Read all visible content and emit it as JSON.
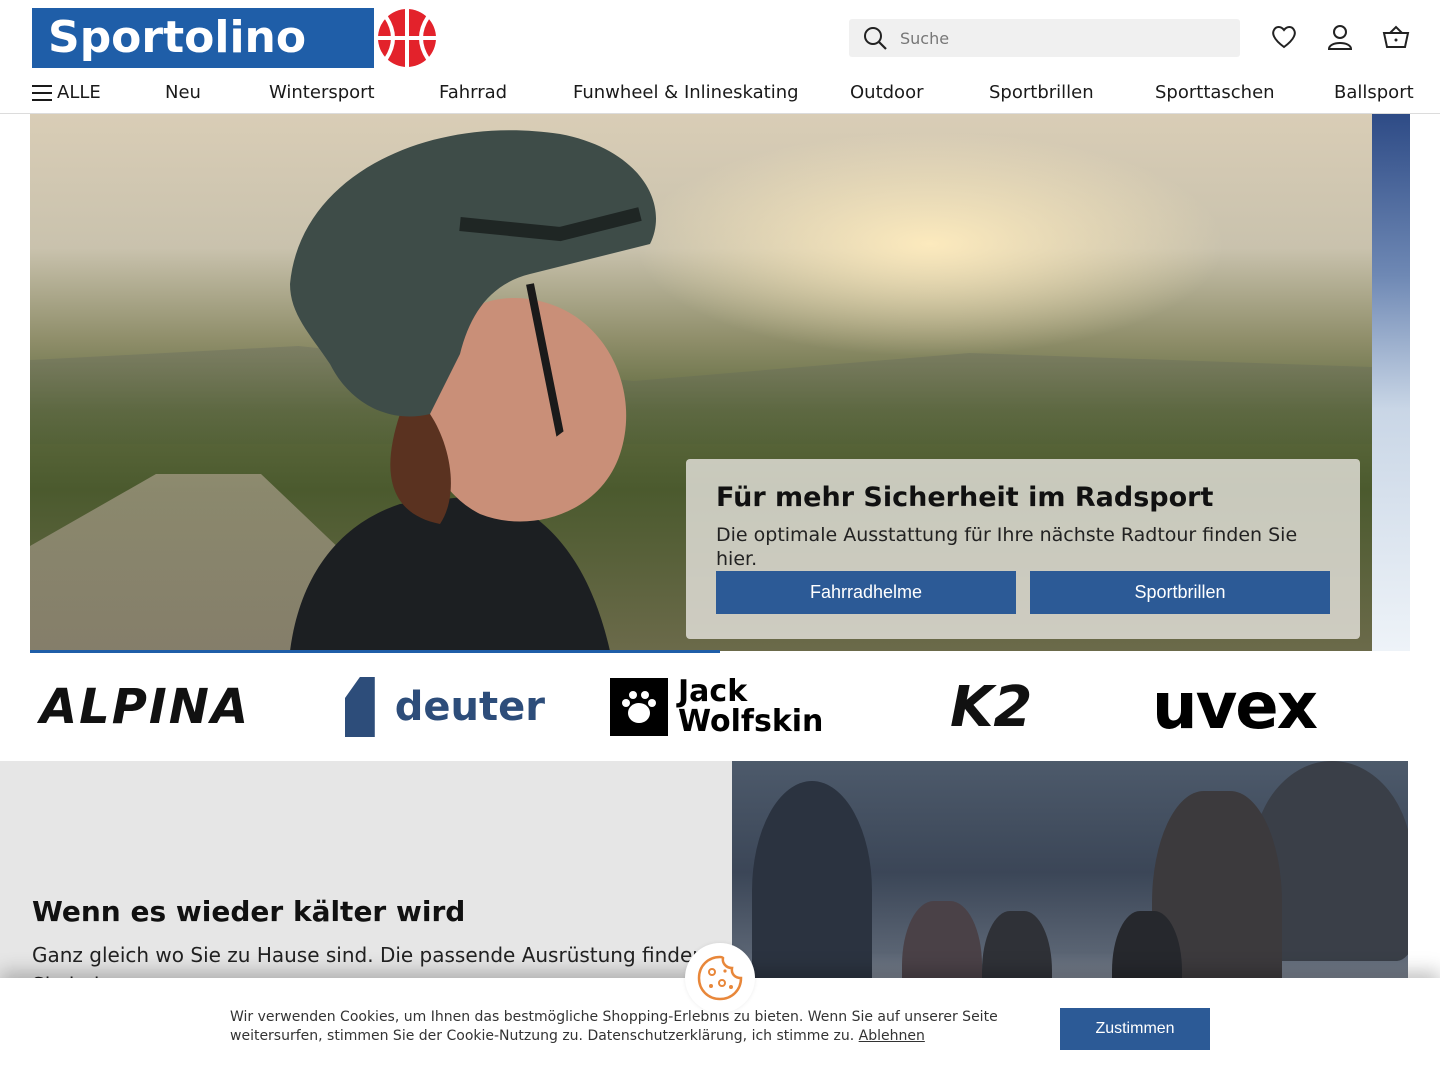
{
  "brand": {
    "logo_text": "Sportolino"
  },
  "search": {
    "placeholder": "Suche"
  },
  "header_icons": [
    "heart-icon",
    "user-icon",
    "basket-icon"
  ],
  "nav": {
    "all_label": "ALLE",
    "items": [
      "Neu",
      "Wintersport",
      "Fahrrad",
      "Funwheel & Inlineskating",
      "Outdoor",
      "Sportbrillen",
      "Sporttaschen",
      "Ballsport"
    ]
  },
  "hero": {
    "title": "Für mehr Sicherheit im Radsport",
    "subtitle": "Die optimale Ausstattung für Ihre nächste Radtour finden Sie hier.",
    "buttons": [
      "Fahrradhelme",
      "Sportbrillen"
    ]
  },
  "brands": {
    "alpina": "ALPINA",
    "deuter": "deuter",
    "jack_line1": "Jack",
    "jack_line2": "Wolfskin",
    "k2": "K2",
    "uvex": "uvex"
  },
  "section": {
    "title": "Wenn es wieder kälter wird",
    "subtitle": "Ganz gleich wo Sie zu Hause sind. Die passende Ausrüstung finden Sie bei uns."
  },
  "cookie": {
    "text": "Wir verwenden Cookies, um Ihnen das bestmögliche Shopping-Erlebnis zu bieten. Wenn Sie auf unserer Seite weitersurfen, stimmen Sie der Cookie-Nutzung zu. Datenschutzerklärung, ich stimme zu. ",
    "decline": "Ablehnen",
    "accept": "Zustimmen"
  },
  "colors": {
    "brand_blue": "#1f5ea8",
    "button_blue": "#2c5a96"
  }
}
